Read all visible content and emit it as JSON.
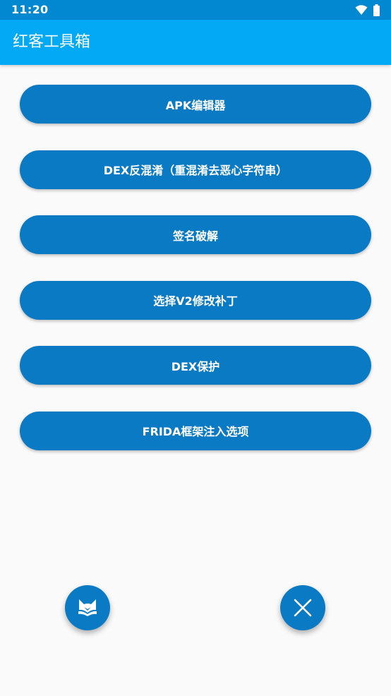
{
  "status_bar": {
    "time": "11:20",
    "icons": [
      "wifi-icon",
      "battery-icon"
    ]
  },
  "app_bar": {
    "title": "红客工具箱"
  },
  "buttons": [
    {
      "label": "APK编辑器"
    },
    {
      "label": "DEX反混淆（重混淆去恶心字符串）"
    },
    {
      "label": "签名破解"
    },
    {
      "label": "选择V2修改补丁"
    },
    {
      "label": "DEX保护"
    },
    {
      "label": "FRIDA框架注入选项"
    }
  ],
  "fabs": {
    "left_icon": "fox-book-icon",
    "right_icon": "close-icon"
  },
  "colors": {
    "status_bar": "#0288d1",
    "app_bar": "#03a9f4",
    "button": "#0a7ac4",
    "background": "#fafafa"
  }
}
